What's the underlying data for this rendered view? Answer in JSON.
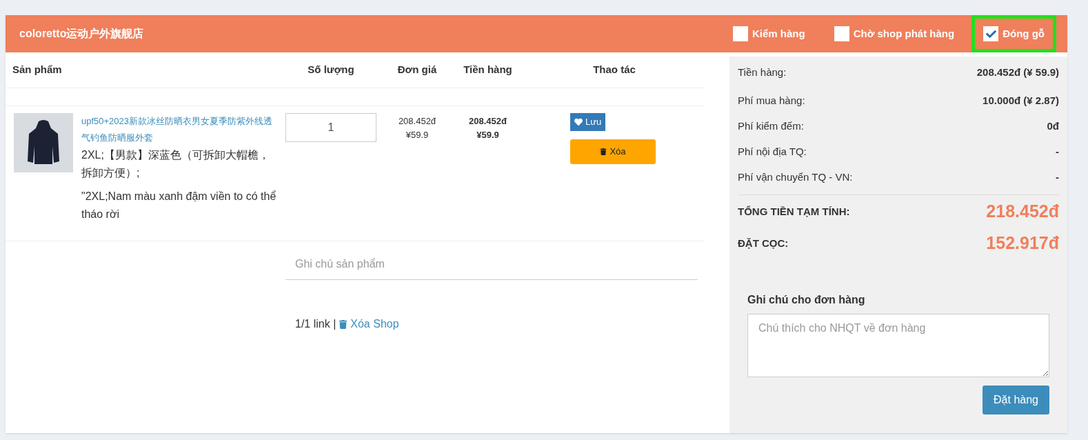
{
  "shop": {
    "name": "coloretto运动户外旗舰店",
    "options": [
      {
        "label": "Kiểm hàng",
        "checked": false,
        "highlighted": false
      },
      {
        "label": "Chờ shop phát hàng",
        "checked": false,
        "highlighted": false
      },
      {
        "label": "Đóng gỗ",
        "checked": true,
        "highlighted": true
      }
    ]
  },
  "table": {
    "columns": [
      "Sản phẩm",
      "Số lượng",
      "Đơn giá",
      "Tiền hàng",
      "Thao tác"
    ],
    "rows": [
      {
        "title": "upf50+2023新款冰丝防晒衣男女夏季防紫外线透气钓鱼防晒服外套",
        "variant": "2XL;【男款】深蓝色（可拆卸大帽檐，拆卸方便）;",
        "variant_vi": "\"2XL;Nam màu xanh đậm viền to có thể tháo rời",
        "quantity": "1",
        "unit_price": "208.452đ",
        "unit_price_cny": "¥59.9",
        "total": "208.452đ",
        "total_cny": "¥59.9",
        "save_label": "Lưu",
        "delete_label": "Xóa",
        "note_placeholder": "Ghi chú sản phẩm"
      }
    ]
  },
  "footer": {
    "count": "1/1 link |",
    "delete_shop": "Xóa Shop"
  },
  "summary": {
    "lines": [
      {
        "label": "Tiền hàng:",
        "value": "208.452đ (¥ 59.9)"
      },
      {
        "label": "Phí mua hàng:",
        "value": "10.000đ (¥ 2.87)"
      },
      {
        "label": "Phí kiểm đếm:",
        "value": "0đ"
      },
      {
        "label": "Phí nội địa TQ:",
        "value": "-"
      },
      {
        "label": "Phí vận chuyển TQ - VN:",
        "value": "-"
      }
    ],
    "totals": [
      {
        "label": "TỔNG TIỀN TẠM TÍNH:",
        "value": "218.452đ"
      },
      {
        "label": "ĐẶT CỌC:",
        "value": "152.917đ"
      }
    ],
    "note_label": "Ghi chú cho đơn hàng",
    "note_placeholder": "Chú thích cho NHQT về đơn hàng",
    "order_button": "Đặt hàng"
  }
}
